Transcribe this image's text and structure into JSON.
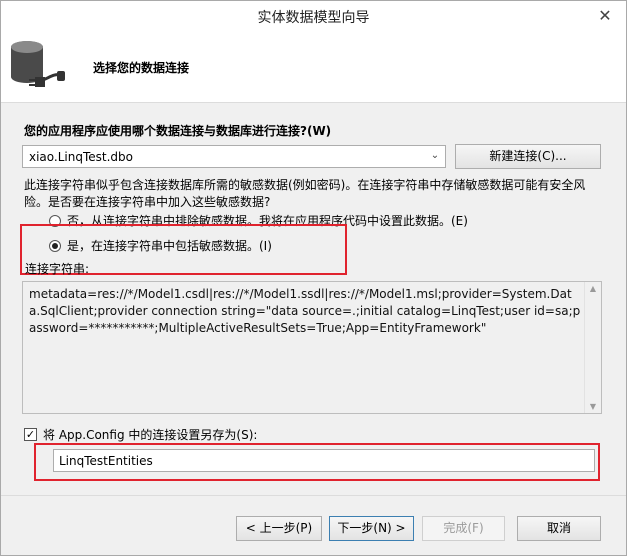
{
  "window": {
    "title": "实体数据模型向导",
    "close_icon": "✕"
  },
  "header": {
    "title": "选择您的数据连接"
  },
  "question": "您的应用程序应使用哪个数据连接与数据库进行连接?(W)",
  "connection_combo": {
    "value": "xiao.LinqTest.dbo",
    "arrow": "⌄"
  },
  "new_connection_button": "新建连接(C)...",
  "warning_text": "此连接字符串似乎包含连接数据库所需的敏感数据(例如密码)。在连接字符串中存储敏感数据可能有安全风险。是否要在连接字符串中加入这些敏感数据?",
  "radio_exclude": {
    "label": "否，从连接字符串中排除敏感数据。我将在应用程序代码中设置此数据。(E)",
    "checked": false
  },
  "radio_include": {
    "label": "是，在连接字符串中包括敏感数据。(I)",
    "checked": true
  },
  "connection_string_label": "连接字符串:",
  "connection_string": "metadata=res://*/Model1.csdl|res://*/Model1.ssdl|res://*/Model1.msl;provider=System.Data.SqlClient;provider connection string=\"data source=.;initial catalog=LinqTest;user id=sa;password=***********;MultipleActiveResultSets=True;App=EntityFramework\"",
  "save_config": {
    "label": "将 App.Config 中的连接设置另存为(S):",
    "checked": true,
    "value": "LinqTestEntities"
  },
  "footer": {
    "back_label": "< 上一步(P)",
    "next_label": "下一步(N) >",
    "finish_label": "完成(F)",
    "cancel_label": "取消"
  },
  "highlight_color": "#e0232e"
}
